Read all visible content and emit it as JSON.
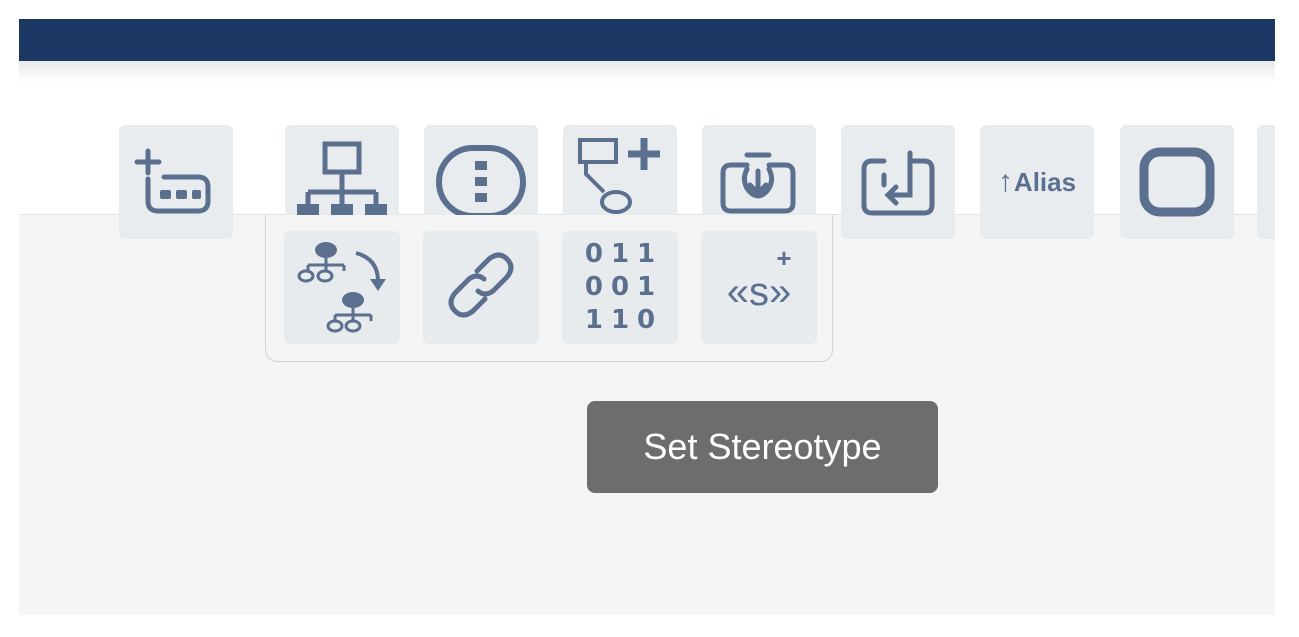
{
  "toolbar": {
    "buttons": [
      {
        "icon": "add-attribute-icon"
      },
      {
        "icon": "hierarchy-icon"
      },
      {
        "icon": "vertical-ellipsis-circle-icon"
      },
      {
        "icon": "add-child-node-icon"
      },
      {
        "icon": "import-into-icon"
      },
      {
        "icon": "return-icon"
      },
      {
        "icon": "alias-icon",
        "label": "Alias",
        "arrow": "↑"
      },
      {
        "icon": "rounded-square-icon"
      }
    ]
  },
  "popup": {
    "buttons": [
      {
        "icon": "reparent-tree-icon"
      },
      {
        "icon": "link-icon"
      },
      {
        "icon": "binary-data-icon",
        "rows": [
          "011",
          "001",
          "110"
        ]
      },
      {
        "icon": "add-stereotype-icon",
        "label": "«s»",
        "plus": "+"
      }
    ]
  },
  "tooltip": {
    "text": "Set Stereotype"
  },
  "colors": {
    "titlebar": "#1c3763",
    "icon": "#5b6f8f",
    "button_bg": "#e9ecef",
    "tooltip_bg": "#6d6d6d",
    "canvas_bg": "#f5f5f5"
  }
}
